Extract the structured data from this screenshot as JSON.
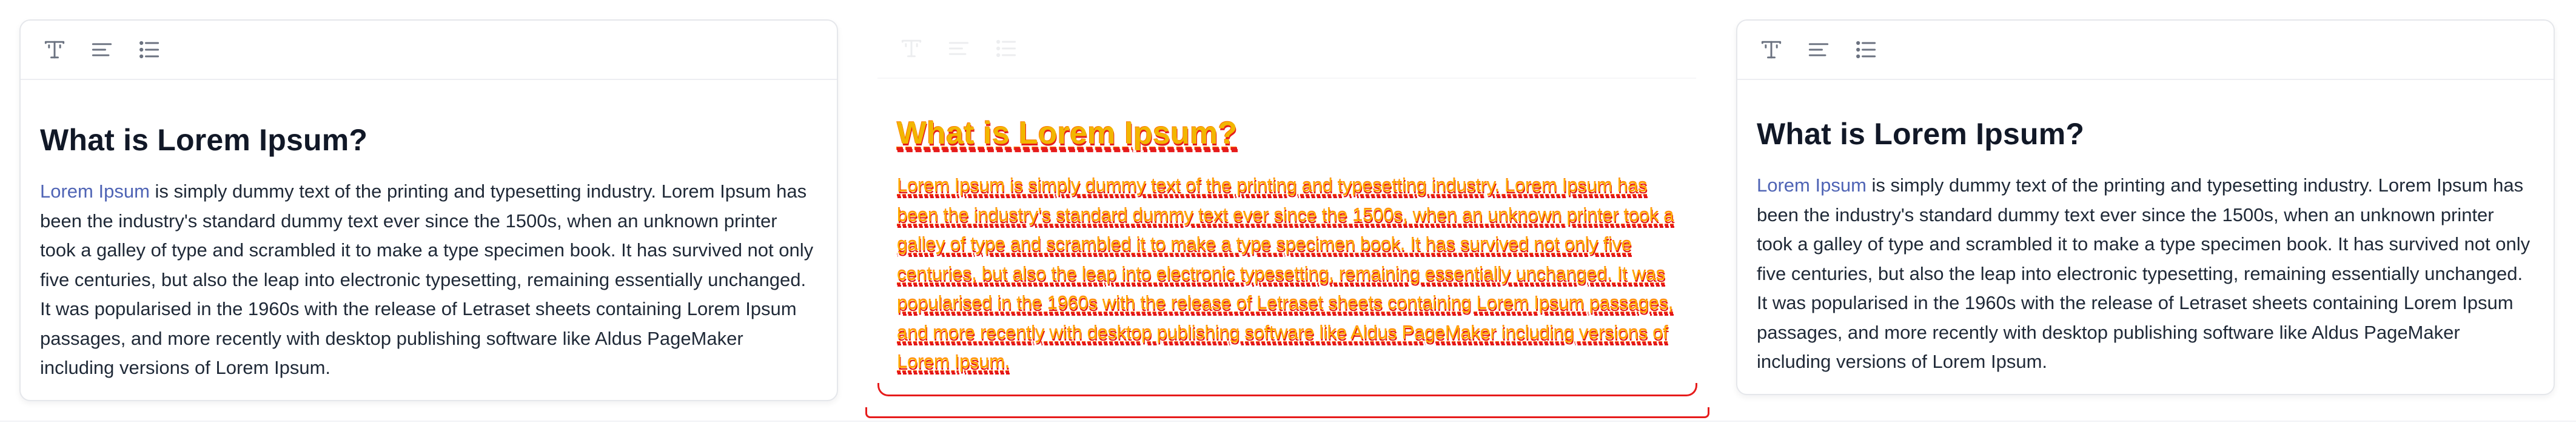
{
  "toolbar": {
    "items": [
      {
        "icon": "text-style-icon"
      },
      {
        "icon": "align-left-icon"
      },
      {
        "icon": "list-icon"
      }
    ]
  },
  "editor": {
    "title": "What is Lorem Ipsum?",
    "link_text": "Lorem Ipsum",
    "paragraph_rest": " is simply dummy text of the printing and typesetting industry. Lorem Ipsum has been the industry's standard dummy text ever since the 1500s, when an unknown printer took a galley of type and scrambled it to make a type specimen book. It has survived not only five centuries, but also the leap into electronic typesetting, remaining essentially unchanged. It was popularised in the 1960s with the release of Letraset sheets containing Lorem Ipsum passages, and more recently with desktop publishing software like Aldus PageMaker including versions of Lorem Ipsum.",
    "glitch_paragraph": "Lorem Ipsum is simply dummy text of the printing and typesetting industry. Lorem Ipsum has been the industry's standard dummy text ever since the 1500s, when an unknown printer took a galley of type and scrambled it to make a type specimen book. It has survived not only five centuries, but also the leap into electronic typesetting, remaining essentially unchanged. It was popularised in the 1960s with the release of Letraset sheets containing Lorem Ipsum passages, and more recently with desktop publishing software like Aldus PageMaker including versions of Lorem Ipsum."
  },
  "colors": {
    "link": "#4f64b5",
    "heading": "#111827",
    "text": "#1f2937",
    "glitch_primary": "#ffb000",
    "glitch_shadow": "#e31414"
  }
}
